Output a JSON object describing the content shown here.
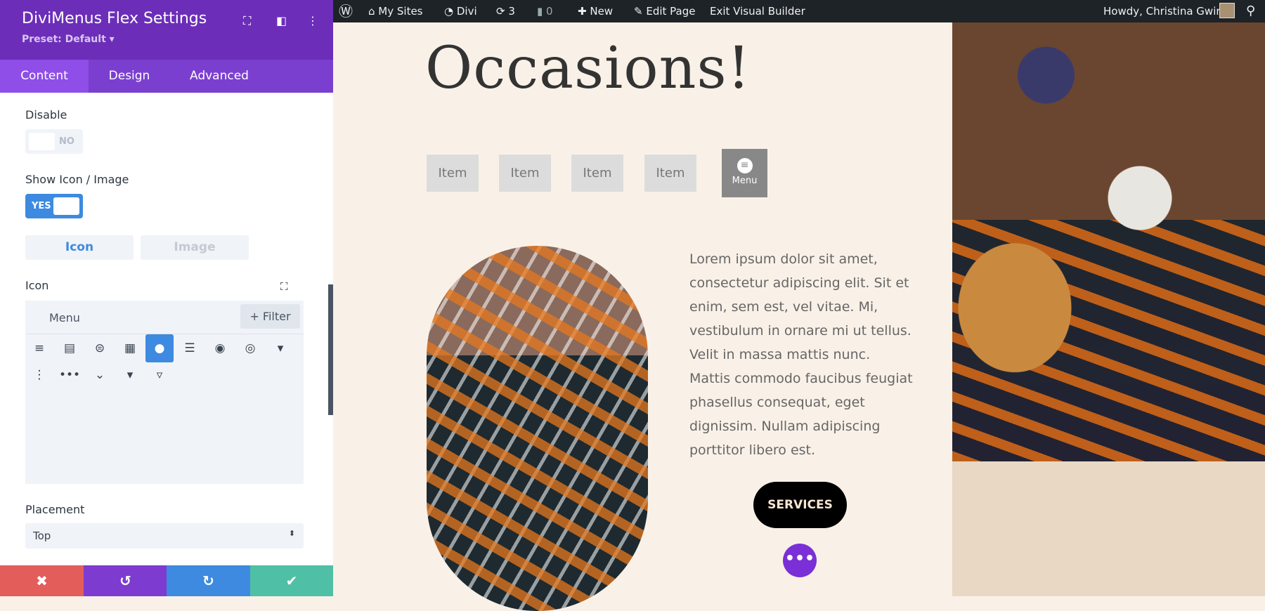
{
  "panel": {
    "title": "DiviMenus Flex Settings",
    "preset": "Preset: Default ▾",
    "tabs": [
      "Content",
      "Design",
      "Advanced"
    ],
    "disable": {
      "label": "Disable",
      "value": "NO"
    },
    "show_icon": {
      "label": "Show Icon / Image",
      "value": "YES"
    },
    "segments": [
      "Icon",
      "Image"
    ],
    "icon": {
      "label": "Icon",
      "search": "Menu",
      "filter": "+ Filter",
      "icons": [
        "≡",
        "▤",
        "⊜",
        "▦",
        "●",
        "☰",
        "◉",
        "◎",
        "▾",
        "⋮",
        "•••",
        "⌄",
        "▾",
        "▿"
      ]
    },
    "placement": {
      "label": "Placement",
      "value": "Top"
    },
    "footer": [
      "✖",
      "↺",
      "↻",
      "✔"
    ]
  },
  "adminbar": {
    "my_sites": "My Sites",
    "divi": "Divi",
    "updates": "3",
    "comments": "0",
    "new": "New",
    "edit_page": "Edit Page",
    "exit": "Exit Visual Builder",
    "howdy": "Howdy, Christina Gwira"
  },
  "page": {
    "heading": "Occasions!",
    "items": [
      "Item",
      "Item",
      "Item",
      "Item"
    ],
    "menu_label": "Menu",
    "paragraph": "Lorem ipsum dolor sit amet, consectetur adipiscing elit. Sit et enim, sem est, vel vitae. Mi, vestibulum in ornare mi ut tellus. Velit in massa mattis nunc. Mattis commodo faucibus feugiat phasellus consequat, eget dignissim. Nullam adipiscing porttitor libero est.",
    "services": "SERVICES",
    "dots": "•••"
  },
  "colors": {
    "purple": "#6c2eb9",
    "accent": "#3d8ae0",
    "red": "#e35d5a",
    "teal": "#4fc0a6"
  }
}
